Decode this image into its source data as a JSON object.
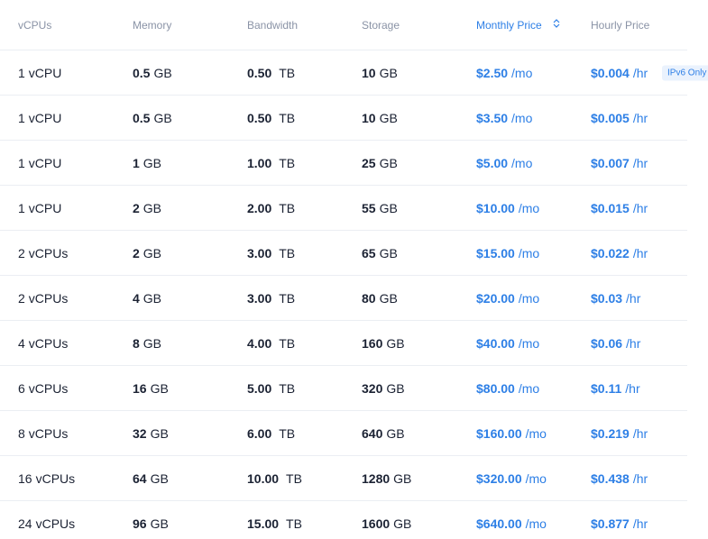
{
  "header": {
    "vcpus": "vCPUs",
    "memory": "Memory",
    "bandwidth": "Bandwidth",
    "storage": "Storage",
    "monthly_price": "Monthly Price",
    "hourly_price": "Hourly Price",
    "sort_icon": "sort-icon"
  },
  "colors": {
    "accent": "#2d7fe6",
    "text": "#1b2233",
    "muted": "#8a93a6",
    "divider": "#ebeef3",
    "badge_bg": "#eaf2fd"
  },
  "rows": [
    {
      "vcpu_num": "1",
      "vcpu_unit": "vCPU",
      "mem_num": "0.5",
      "mem_unit": "GB",
      "bw_num": "0.50",
      "bw_unit": "TB",
      "st_num": "10",
      "st_unit": "GB",
      "mo_num": "$2.50",
      "mo_unit": "/mo",
      "hr_num": "$0.004",
      "hr_unit": "/hr",
      "badge": "IPv6 Only"
    },
    {
      "vcpu_num": "1",
      "vcpu_unit": "vCPU",
      "mem_num": "0.5",
      "mem_unit": "GB",
      "bw_num": "0.50",
      "bw_unit": "TB",
      "st_num": "10",
      "st_unit": "GB",
      "mo_num": "$3.50",
      "mo_unit": "/mo",
      "hr_num": "$0.005",
      "hr_unit": "/hr"
    },
    {
      "vcpu_num": "1",
      "vcpu_unit": "vCPU",
      "mem_num": "1",
      "mem_unit": "GB",
      "bw_num": "1.00",
      "bw_unit": "TB",
      "st_num": "25",
      "st_unit": "GB",
      "mo_num": "$5.00",
      "mo_unit": "/mo",
      "hr_num": "$0.007",
      "hr_unit": "/hr"
    },
    {
      "vcpu_num": "1",
      "vcpu_unit": "vCPU",
      "mem_num": "2",
      "mem_unit": "GB",
      "bw_num": "2.00",
      "bw_unit": "TB",
      "st_num": "55",
      "st_unit": "GB",
      "mo_num": "$10.00",
      "mo_unit": "/mo",
      "hr_num": "$0.015",
      "hr_unit": "/hr"
    },
    {
      "vcpu_num": "2",
      "vcpu_unit": "vCPUs",
      "mem_num": "2",
      "mem_unit": "GB",
      "bw_num": "3.00",
      "bw_unit": "TB",
      "st_num": "65",
      "st_unit": "GB",
      "mo_num": "$15.00",
      "mo_unit": "/mo",
      "hr_num": "$0.022",
      "hr_unit": "/hr"
    },
    {
      "vcpu_num": "2",
      "vcpu_unit": "vCPUs",
      "mem_num": "4",
      "mem_unit": "GB",
      "bw_num": "3.00",
      "bw_unit": "TB",
      "st_num": "80",
      "st_unit": "GB",
      "mo_num": "$20.00",
      "mo_unit": "/mo",
      "hr_num": "$0.03",
      "hr_unit": "/hr"
    },
    {
      "vcpu_num": "4",
      "vcpu_unit": "vCPUs",
      "mem_num": "8",
      "mem_unit": "GB",
      "bw_num": "4.00",
      "bw_unit": "TB",
      "st_num": "160",
      "st_unit": "GB",
      "mo_num": "$40.00",
      "mo_unit": "/mo",
      "hr_num": "$0.06",
      "hr_unit": "/hr"
    },
    {
      "vcpu_num": "6",
      "vcpu_unit": "vCPUs",
      "mem_num": "16",
      "mem_unit": "GB",
      "bw_num": "5.00",
      "bw_unit": "TB",
      "st_num": "320",
      "st_unit": "GB",
      "mo_num": "$80.00",
      "mo_unit": "/mo",
      "hr_num": "$0.11",
      "hr_unit": "/hr"
    },
    {
      "vcpu_num": "8",
      "vcpu_unit": "vCPUs",
      "mem_num": "32",
      "mem_unit": "GB",
      "bw_num": "6.00",
      "bw_unit": "TB",
      "st_num": "640",
      "st_unit": "GB",
      "mo_num": "$160.00",
      "mo_unit": "/mo",
      "hr_num": "$0.219",
      "hr_unit": "/hr"
    },
    {
      "vcpu_num": "16",
      "vcpu_unit": "vCPUs",
      "mem_num": "64",
      "mem_unit": "GB",
      "bw_num": "10.00",
      "bw_unit": "TB",
      "st_num": "1280",
      "st_unit": "GB",
      "mo_num": "$320.00",
      "mo_unit": "/mo",
      "hr_num": "$0.438",
      "hr_unit": "/hr"
    },
    {
      "vcpu_num": "24",
      "vcpu_unit": "vCPUs",
      "mem_num": "96",
      "mem_unit": "GB",
      "bw_num": "15.00",
      "bw_unit": "TB",
      "st_num": "1600",
      "st_unit": "GB",
      "mo_num": "$640.00",
      "mo_unit": "/mo",
      "hr_num": "$0.877",
      "hr_unit": "/hr"
    }
  ]
}
